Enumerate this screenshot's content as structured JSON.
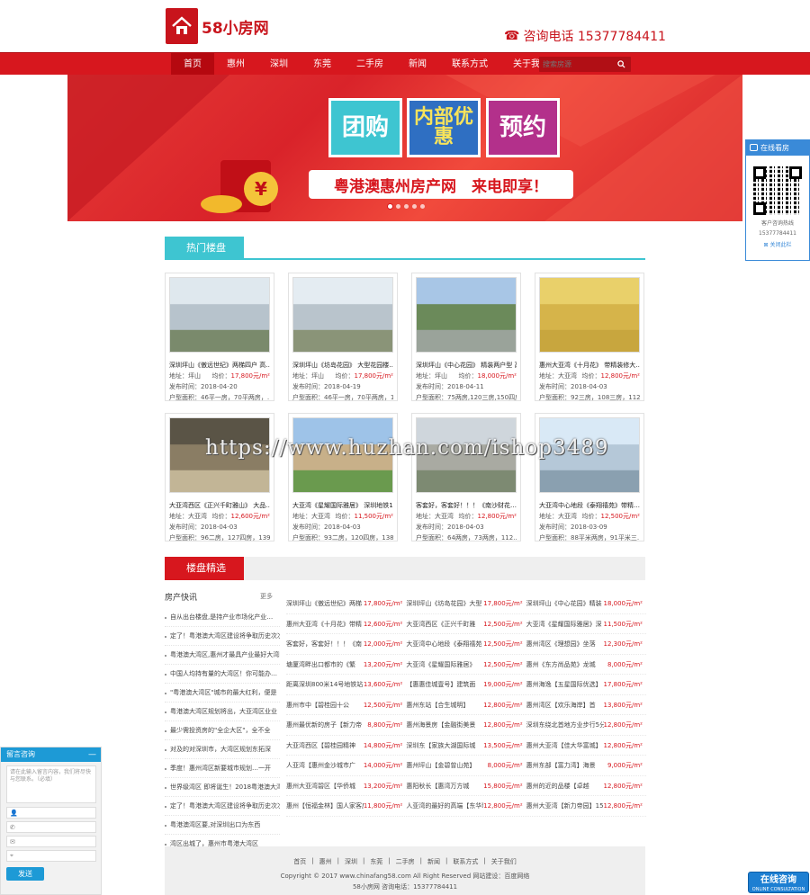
{
  "header": {
    "logo_text": "58小房网",
    "hotline": "咨询电话 15377784411"
  },
  "nav": {
    "items": [
      "首页",
      "惠州",
      "深圳",
      "东莞",
      "二手房",
      "新闻",
      "联系方式",
      "关于我们"
    ],
    "active_index": 0,
    "search_placeholder": "搜索房源"
  },
  "banner": {
    "tags": [
      "团购",
      "内部优惠",
      "预约"
    ],
    "slogan": "粤港澳惠州房产网　来电即享！",
    "coin_symbol": "¥",
    "slides": 5,
    "active_slide": 0
  },
  "hot_section": {
    "title": "热门楼盘"
  },
  "listings": [
    {
      "title": "深圳坪山《傲远世纪》两梯四户 高…",
      "addr_label": "地址：",
      "addr": "坪山",
      "price_label": "均价：",
      "price": "17,800元/m²",
      "date": "发布时间：2018-04-20",
      "area": "户型面积：46平一房，70平两房，…",
      "palette": [
        "#dfe8ee",
        "#b7c3cc",
        "#7a8a6c"
      ]
    },
    {
      "title": "深圳坪山《坊岛花园》 大型花园楼…",
      "addr_label": "地址：",
      "addr": "坪山",
      "price_label": "均价：",
      "price": "17,800元/m²",
      "date": "发布时间：2018-04-19",
      "area": "户型面积：46平一房，70平两房，1…",
      "palette": [
        "#e4ecf2",
        "#b9c4cc",
        "#8a9478"
      ]
    },
    {
      "title": "深圳坪山《中心花园》 精装两户型 高…",
      "addr_label": "地址：",
      "addr": "坪山",
      "price_label": "均价：",
      "price": "18,000元/m²",
      "date": "发布时间：2018-04-11",
      "area": "户型面积：75两房,120三房,150四房",
      "palette": [
        "#a8c6e6",
        "#6b8a5a",
        "#9aa39a"
      ]
    },
    {
      "title": "惠州大亚湾《十月花》 带精装修大…",
      "addr_label": "地址：",
      "addr": "大亚湾",
      "price_label": "均价：",
      "price": "12,800元/m²",
      "date": "发布时间：2018-04-03",
      "area": "户型面积：92三房，108三房，112…",
      "palette": [
        "#e9d06a",
        "#d6b44a",
        "#c8a63e"
      ]
    },
    {
      "title": "大亚湾西区《正兴千町雅山》 大品…",
      "addr_label": "地址：",
      "addr": "大亚湾",
      "price_label": "均价：",
      "price": "12,600元/m²",
      "date": "发布时间：2018-04-03",
      "area": "户型面积：96二房，127四房，139…",
      "palette": [
        "#5a5446",
        "#8a7d64",
        "#c2b596"
      ]
    },
    {
      "title": "大亚湾《星耀国际雅居》 深圳地铁1…",
      "addr_label": "地址：",
      "addr": "大亚湾",
      "price_label": "均价：",
      "price": "11,500元/m²",
      "date": "发布时间：2018-04-03",
      "area": "户型面积：93二房，120四房，138…",
      "palette": [
        "#9ec3e8",
        "#c8b089",
        "#6a9a4e"
      ]
    },
    {
      "title": "客套好，客套好！！！《南沙财花…",
      "addr_label": "地址：",
      "addr": "大亚湾",
      "price_label": "均价：",
      "price": "12,800元/m²",
      "date": "发布时间：2018-04-03",
      "area": "户型面积：64两房，73两房，112…",
      "palette": [
        "#cfd6dc",
        "#a9aaa2",
        "#7d8a72"
      ]
    },
    {
      "title": "大亚湾中心地段《泰翔禧苑》带精…",
      "addr_label": "地址：",
      "addr": "大亚湾",
      "price_label": "均价：",
      "price": "12,500元/m²",
      "date": "发布时间：2018-03-09",
      "area": "户型面积：88平米两房，91平米三…",
      "palette": [
        "#d9e9f6",
        "#b5c8d8",
        "#8aa0b0"
      ]
    }
  ],
  "select_section": {
    "title": "楼盘精选"
  },
  "news": {
    "title": "房产快讯",
    "more": "更多",
    "items": [
      "自从出台楼盘,是持产业市场化产业…",
      "定了！粤港澳大湾区建设将争取历史次次",
      "粤港澳大湾区,惠州才最具产业最好大湾区",
      "中国人均持有量的大湾区！你可能办…",
      "\"粤港澳大湾区\"城市的最大红利，便是",
      "粤港澳大湾区规划将出，大亚湾区业业",
      "最少需投资房的\"全企大区\"，全不全",
      "对及的对深圳市，大湾区规划东拓深",
      "季度！惠州湾区新要城市规划…一开",
      "世界级湾区 即将诞生！2018粤港澳大湾区",
      "定了！粤港澳大湾区建设将争取历史次次",
      "粤港澳湾区要,对深圳出口为东西",
      "湾区出城了，惠州市粤港大湾区"
    ]
  },
  "grid": [
    [
      {
        "n": "深圳坪山《傲远世纪》两梯",
        "p": "17,800元/m²"
      },
      {
        "n": "深圳坪山《坊岛花园》大型",
        "p": "17,800元/m²"
      },
      {
        "n": "深圳坪山《中心花园》精装",
        "p": "18,000元/m²"
      }
    ],
    [
      {
        "n": "惠州大亚湾《十月花》带精",
        "p": "12,600元/m²"
      },
      {
        "n": "大亚湾西区《正兴千町雅",
        "p": "12,500元/m²"
      },
      {
        "n": "大亚湾《星耀国际雅居》深",
        "p": "11,500元/m²"
      }
    ],
    [
      {
        "n": "客套好，客套好！！！《南",
        "p": "12,000元/m²"
      },
      {
        "n": "大亚湾中心地段《泰翔禧苑",
        "p": "12,500元/m²"
      },
      {
        "n": "惠州湾区《理想园》坐落",
        "p": "12,300元/m²"
      }
    ],
    [
      {
        "n": "塘厦湾畔出口都市的《繁",
        "p": "13,200元/m²"
      },
      {
        "n": "大亚湾《星耀国际雅居》",
        "p": "12,500元/m²"
      },
      {
        "n": "惠州《东方尚品苑》龙城",
        "p": "8,000元/m²"
      }
    ],
    [
      {
        "n": "距离深圳800米14号地铁站",
        "p": "13,600元/m²"
      },
      {
        "n": "【惠惠佳城壹号】建筑面",
        "p": "19,000元/m²"
      },
      {
        "n": "惠州海逸【五星国际优选】",
        "p": "17,800元/m²"
      }
    ],
    [
      {
        "n": "惠州市中【碧桂园十公",
        "p": "12,500元/m²"
      },
      {
        "n": "惠州东站【合生城明】",
        "p": "12,800元/m²"
      },
      {
        "n": "惠州湾区【欢乐海岸】首",
        "p": "13,800元/m²"
      }
    ],
    [
      {
        "n": "惠州最优新的房子【新力帝",
        "p": "8,800元/m²"
      },
      {
        "n": "惠州海景房【金融街美景",
        "p": "12,800元/m²"
      },
      {
        "n": "深圳东绕北首地方业步行5分",
        "p": "12,800元/m²"
      }
    ],
    [
      {
        "n": "大亚湾西区【碧桂园精神",
        "p": "14,800元/m²"
      },
      {
        "n": "深圳东【家族大湖国际城",
        "p": "13,500元/m²"
      },
      {
        "n": "惠州大亚湾【佳大华富城】",
        "p": "12,800元/m²"
      }
    ],
    [
      {
        "n": "人亚湾【惠州金沙城市广",
        "p": "14,000元/m²"
      },
      {
        "n": "惠州坪山【金碧曾山苑】",
        "p": "8,000元/m²"
      },
      {
        "n": "惠州东部【富力湾】海景",
        "p": "9,000元/m²"
      }
    ],
    [
      {
        "n": "惠州大亚湾碧区【华侨城",
        "p": "13,200元/m²"
      },
      {
        "n": "惠阳秋长【惠湾万方城",
        "p": "15,800元/m²"
      },
      {
        "n": "惠州的近的品楼【卓越",
        "p": "12,800元/m²"
      }
    ],
    [
      {
        "n": "惠州【恒福金林】国人家客房",
        "p": "11,800元/m²"
      },
      {
        "n": "人亚湾的最好的高端【东华城",
        "p": "12,800元/m²"
      },
      {
        "n": "惠州大亚湾【新力帝园】15",
        "p": "12,800元/m²"
      }
    ]
  ],
  "footer": {
    "links": [
      "首页",
      "惠州",
      "深圳",
      "东莞",
      "二手房",
      "新闻",
      "联系方式",
      "关于我们"
    ],
    "copyright": "Copyright © 2017 www.chinafang58.com All Right Reserved  网站建设：百度网络",
    "meta": "58小房网   咨询电话：15377784411"
  },
  "right_float": {
    "title": "在线看房",
    "line1": "客户咨询热线",
    "line2": "15377784411",
    "close": "关闭此栏"
  },
  "message_box": {
    "title": "留言咨询",
    "minimize": "—",
    "placeholder": "请在此输入留言内容，我们将尽快与您联系。（必填）",
    "send": "发送"
  },
  "consult": {
    "title": "在线咨询",
    "sub": "ONLINE CONSULTATION"
  },
  "watermark": "https://www.huzhan.com/ishop3489",
  "colors": {
    "brand_red": "#d7171e",
    "accent_cyan": "#3ec5d1",
    "widget_blue": "#1d9ad6"
  }
}
